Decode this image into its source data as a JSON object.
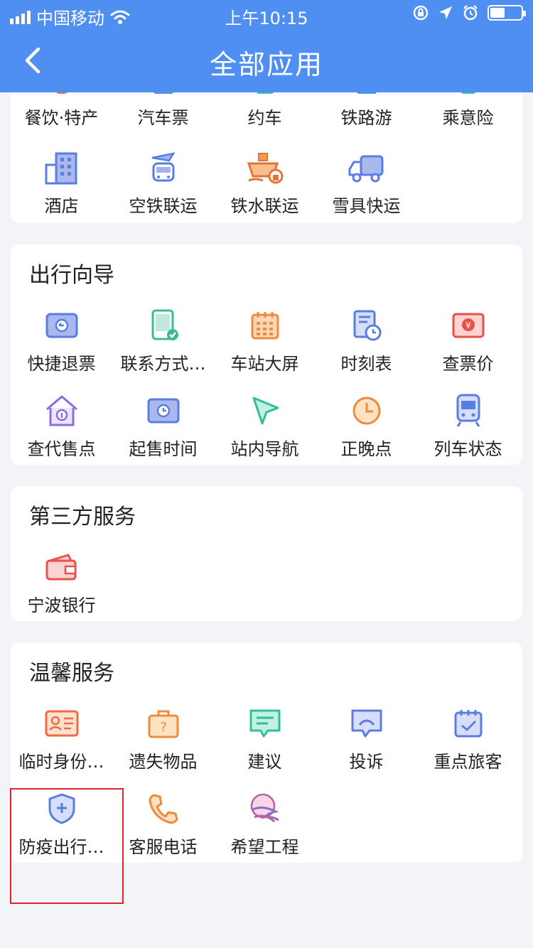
{
  "status": {
    "carrier": "中国移动",
    "time": "上午10:15"
  },
  "header": {
    "title": "全部应用",
    "back_icon": "chevron-left-icon"
  },
  "section_top": {
    "row1": [
      "餐饮·特产",
      "汽车票",
      "约车",
      "铁路游",
      "乘意险"
    ],
    "row2": [
      {
        "label": "酒店",
        "icon": "building-icon"
      },
      {
        "label": "空铁联运",
        "icon": "plane-train-icon"
      },
      {
        "label": "铁水联运",
        "icon": "ship-train-icon"
      },
      {
        "label": "雪具快运",
        "icon": "truck-icon"
      }
    ]
  },
  "section_guide": {
    "title": "出行向导",
    "items": [
      {
        "label": "快捷退票",
        "icon": "refund-ticket-icon"
      },
      {
        "label": "联系方式…",
        "icon": "phone-check-icon"
      },
      {
        "label": "车站大屏",
        "icon": "calendar-grid-icon"
      },
      {
        "label": "时刻表",
        "icon": "schedule-clock-icon"
      },
      {
        "label": "查票价",
        "icon": "yen-ticket-icon"
      },
      {
        "label": "查代售点",
        "icon": "home-agent-icon"
      },
      {
        "label": "起售时间",
        "icon": "ticket-clock-icon"
      },
      {
        "label": "站内导航",
        "icon": "navigation-arrow-icon"
      },
      {
        "label": "正晚点",
        "icon": "clock-icon"
      },
      {
        "label": "列车状态",
        "icon": "train-icon"
      }
    ]
  },
  "section_third": {
    "title": "第三方服务",
    "items": [
      {
        "label": "宁波银行",
        "icon": "wallet-icon"
      }
    ]
  },
  "section_warm": {
    "title": "温馨服务",
    "items": [
      {
        "label": "临时身份…",
        "icon": "id-card-icon"
      },
      {
        "label": "遗失物品",
        "icon": "lost-bag-icon"
      },
      {
        "label": "建议",
        "icon": "suggestion-chat-icon"
      },
      {
        "label": "投诉",
        "icon": "complaint-chat-icon"
      },
      {
        "label": "重点旅客",
        "icon": "calendar-check-icon"
      },
      {
        "label": "防疫出行…",
        "icon": "shield-plus-icon"
      },
      {
        "label": "客服电话",
        "icon": "phone-icon"
      },
      {
        "label": "希望工程",
        "icon": "hope-project-icon"
      }
    ]
  }
}
